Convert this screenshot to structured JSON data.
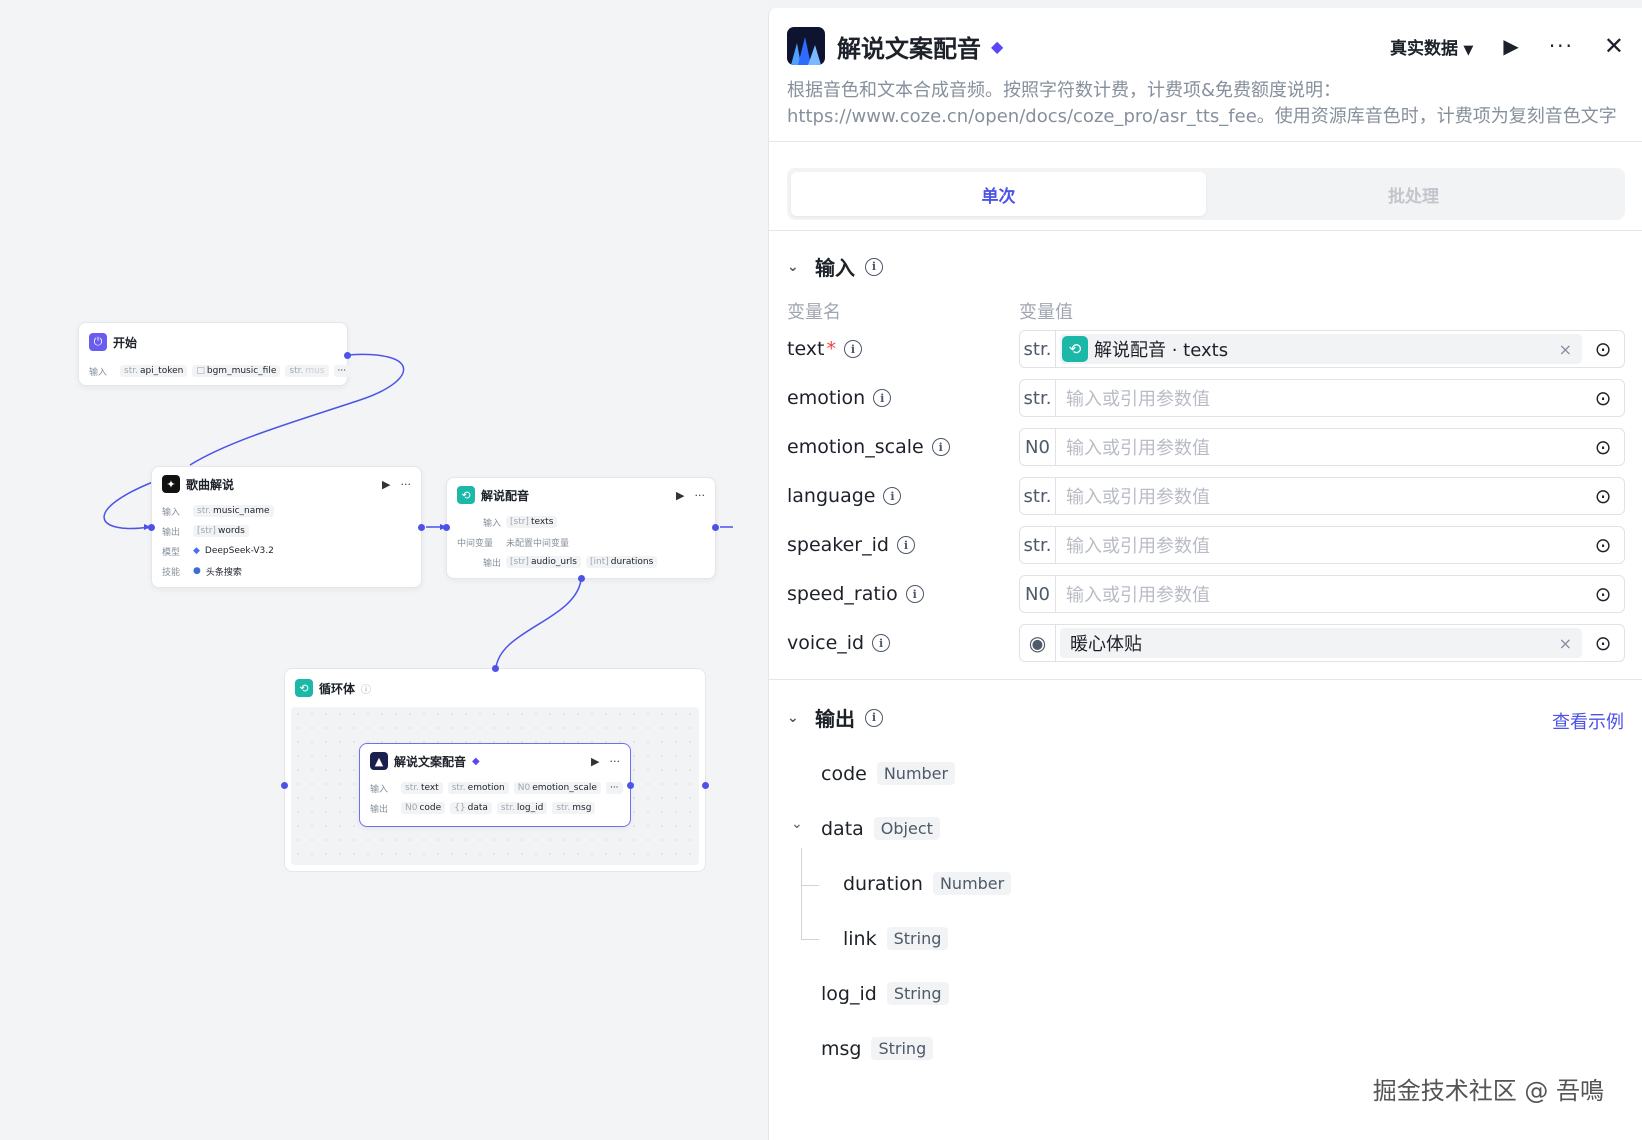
{
  "canvas": {
    "start": {
      "title": "开始",
      "in_label": "输入",
      "params": [
        "api_token",
        "bgm_music_file",
        "mus"
      ],
      "more": "···"
    },
    "song": {
      "title": "歌曲解说",
      "rows": [
        {
          "k": "输入",
          "t": "str.",
          "v": "music_name"
        },
        {
          "k": "输出",
          "t": "[str]",
          "v": "words"
        },
        {
          "k": "模型",
          "t": "",
          "v": "DeepSeek-V3.2"
        },
        {
          "k": "技能",
          "t": "",
          "v": "头条搜索"
        }
      ]
    },
    "dub": {
      "title": "解说配音",
      "in_label": "输入",
      "in_tag_t": "[str]",
      "in_tag": "texts",
      "mid_label": "中间变量",
      "mid_val": "未配置中间变量",
      "out_label": "输出",
      "out_tags": [
        {
          "t": "[str]",
          "v": "audio_urls"
        },
        {
          "t": "[int]",
          "v": "durations"
        }
      ]
    },
    "loop": {
      "title": "循环体"
    },
    "tts": {
      "title": "解说文案配音",
      "in_label": "输入",
      "in_tags": [
        {
          "t": "str.",
          "v": "text"
        },
        {
          "t": "str.",
          "v": "emotion"
        },
        {
          "t": "N0",
          "v": "emotion_scale"
        }
      ],
      "out_label": "输出",
      "out_tags": [
        {
          "t": "N0",
          "v": "code"
        },
        {
          "t": "{}",
          "v": "data"
        },
        {
          "t": "str.",
          "v": "log_id"
        },
        {
          "t": "str.",
          "v": "msg"
        }
      ],
      "more": "···"
    }
  },
  "panel": {
    "title": "解说文案配音",
    "mode": "真实数据",
    "description": "根据音色和文本合成音频。按照字符数计费，计费项&免费额度说明：https://www.coze.cn/open/docs/coze_pro/asr_tts_fee。使用资源库音色时，计费项为复刻音色文字转语音字数；使用预设…",
    "tabs": [
      "单次",
      "批处理"
    ],
    "input_title": "输入",
    "col_name": "变量名",
    "col_value": "变量值",
    "placeholder": "输入或引用参数值",
    "params": [
      {
        "name": "text",
        "required": "*",
        "type": "str.",
        "chip": "解说配音 · texts"
      },
      {
        "name": "emotion",
        "required": "",
        "type": "str.",
        "chip": ""
      },
      {
        "name": "emotion_scale",
        "required": "",
        "type": "N0",
        "chip": ""
      },
      {
        "name": "language",
        "required": "",
        "type": "str.",
        "chip": ""
      },
      {
        "name": "speaker_id",
        "required": "",
        "type": "str.",
        "chip": ""
      },
      {
        "name": "speed_ratio",
        "required": "",
        "type": "N0",
        "chip": ""
      },
      {
        "name": "voice_id",
        "required": "",
        "type": "",
        "chip": "暖心体贴"
      }
    ],
    "output_title": "输出",
    "see_example": "查看示例",
    "outputs": [
      {
        "name": "code",
        "type": "Number"
      },
      {
        "name": "data",
        "type": "Object"
      },
      {
        "name": "duration",
        "type": "Number"
      },
      {
        "name": "link",
        "type": "String"
      },
      {
        "name": "log_id",
        "type": "String"
      },
      {
        "name": "msg",
        "type": "String"
      }
    ]
  },
  "watermark": "掘金技术社区 @ 吾鳴"
}
